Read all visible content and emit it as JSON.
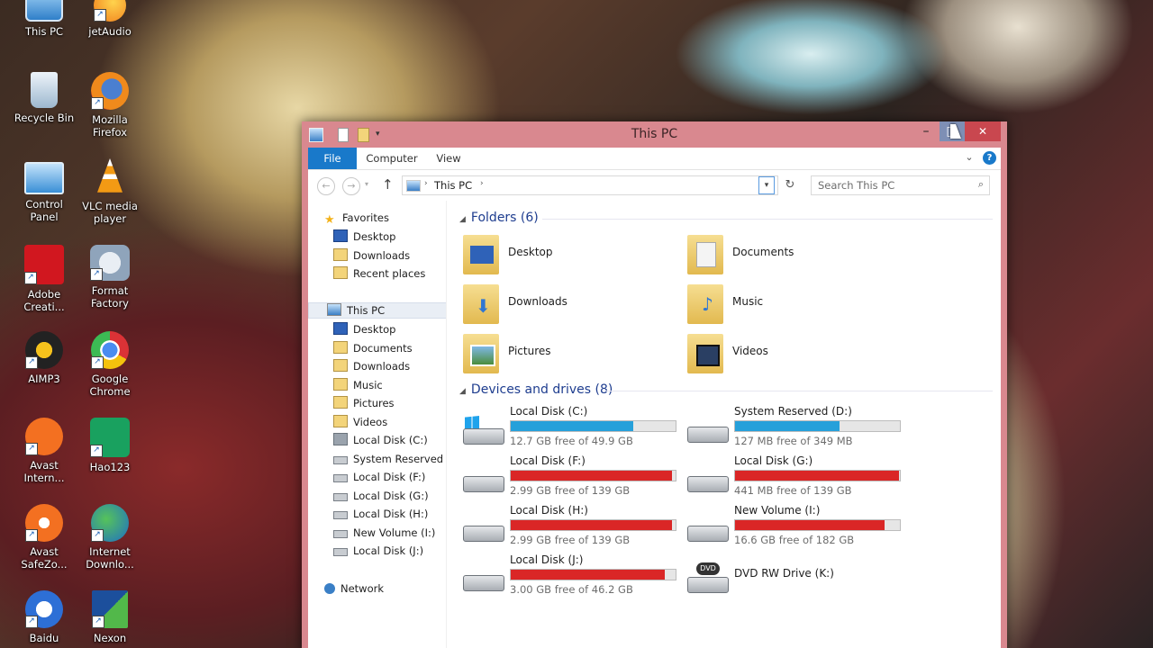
{
  "desktop": {
    "icons": [
      {
        "label": "This PC"
      },
      {
        "label": "jetAudio"
      },
      {
        "label": "Recycle Bin"
      },
      {
        "label": "Mozilla Firefox"
      },
      {
        "label": "Control Panel"
      },
      {
        "label": "VLC media player"
      },
      {
        "label": "Adobe Creati..."
      },
      {
        "label": "Format Factory"
      },
      {
        "label": "AIMP3"
      },
      {
        "label": "Google Chrome"
      },
      {
        "label": "Avast Intern..."
      },
      {
        "label": "Hao123"
      },
      {
        "label": "Avast SafeZo..."
      },
      {
        "label": "Internet Downlo..."
      },
      {
        "label": "Baidu"
      },
      {
        "label": "Nexon"
      }
    ]
  },
  "window": {
    "title": "This PC",
    "caption": {
      "minimize": "–",
      "maximize": "□",
      "close": "✕"
    },
    "ribbon": {
      "tabs": [
        "File",
        "Computer",
        "View"
      ]
    },
    "address": {
      "location": "This PC"
    },
    "search": {
      "placeholder": "Search This PC"
    }
  },
  "navigation": {
    "favorites": {
      "label": "Favorites",
      "items": [
        "Desktop",
        "Downloads",
        "Recent places"
      ]
    },
    "this_pc": {
      "label": "This PC",
      "items": [
        "Desktop",
        "Documents",
        "Downloads",
        "Music",
        "Pictures",
        "Videos",
        "Local Disk (C:)",
        "System Reserved (D:)",
        "Local Disk (F:)",
        "Local Disk (G:)",
        "Local Disk (H:)",
        "New Volume (I:)",
        "Local Disk (J:)"
      ]
    },
    "network": {
      "label": "Network"
    }
  },
  "folders": {
    "header": "Folders (6)",
    "items": [
      {
        "name": "Desktop"
      },
      {
        "name": "Documents"
      },
      {
        "name": "Downloads"
      },
      {
        "name": "Music"
      },
      {
        "name": "Pictures"
      },
      {
        "name": "Videos"
      }
    ]
  },
  "drives": {
    "header": "Devices and drives (8)",
    "items": [
      {
        "name": "Local Disk (C:)",
        "free": "12.7 GB free of 49.9 GB",
        "used_fraction": 0.745,
        "color": "#26a0da"
      },
      {
        "name": "System Reserved (D:)",
        "free": "127 MB free of 349 MB",
        "used_fraction": 0.636,
        "color": "#26a0da"
      },
      {
        "name": "Local Disk (F:)",
        "free": "2.99 GB free of 139 GB",
        "used_fraction": 0.978,
        "color": "#da2626"
      },
      {
        "name": "Local Disk (G:)",
        "free": "441 MB free of 139 GB",
        "used_fraction": 0.997,
        "color": "#da2626"
      },
      {
        "name": "Local Disk (H:)",
        "free": "2.99 GB free of 139 GB",
        "used_fraction": 0.978,
        "color": "#da2626"
      },
      {
        "name": "New Volume (I:)",
        "free": "16.6 GB free of 182 GB",
        "used_fraction": 0.909,
        "color": "#da2626"
      },
      {
        "name": "Local Disk (J:)",
        "free": "3.00 GB free of 46.2 GB",
        "used_fraction": 0.935,
        "color": "#da2626"
      },
      {
        "name": "DVD RW Drive (K:)",
        "free": "",
        "used_fraction": null,
        "color": ""
      }
    ]
  }
}
